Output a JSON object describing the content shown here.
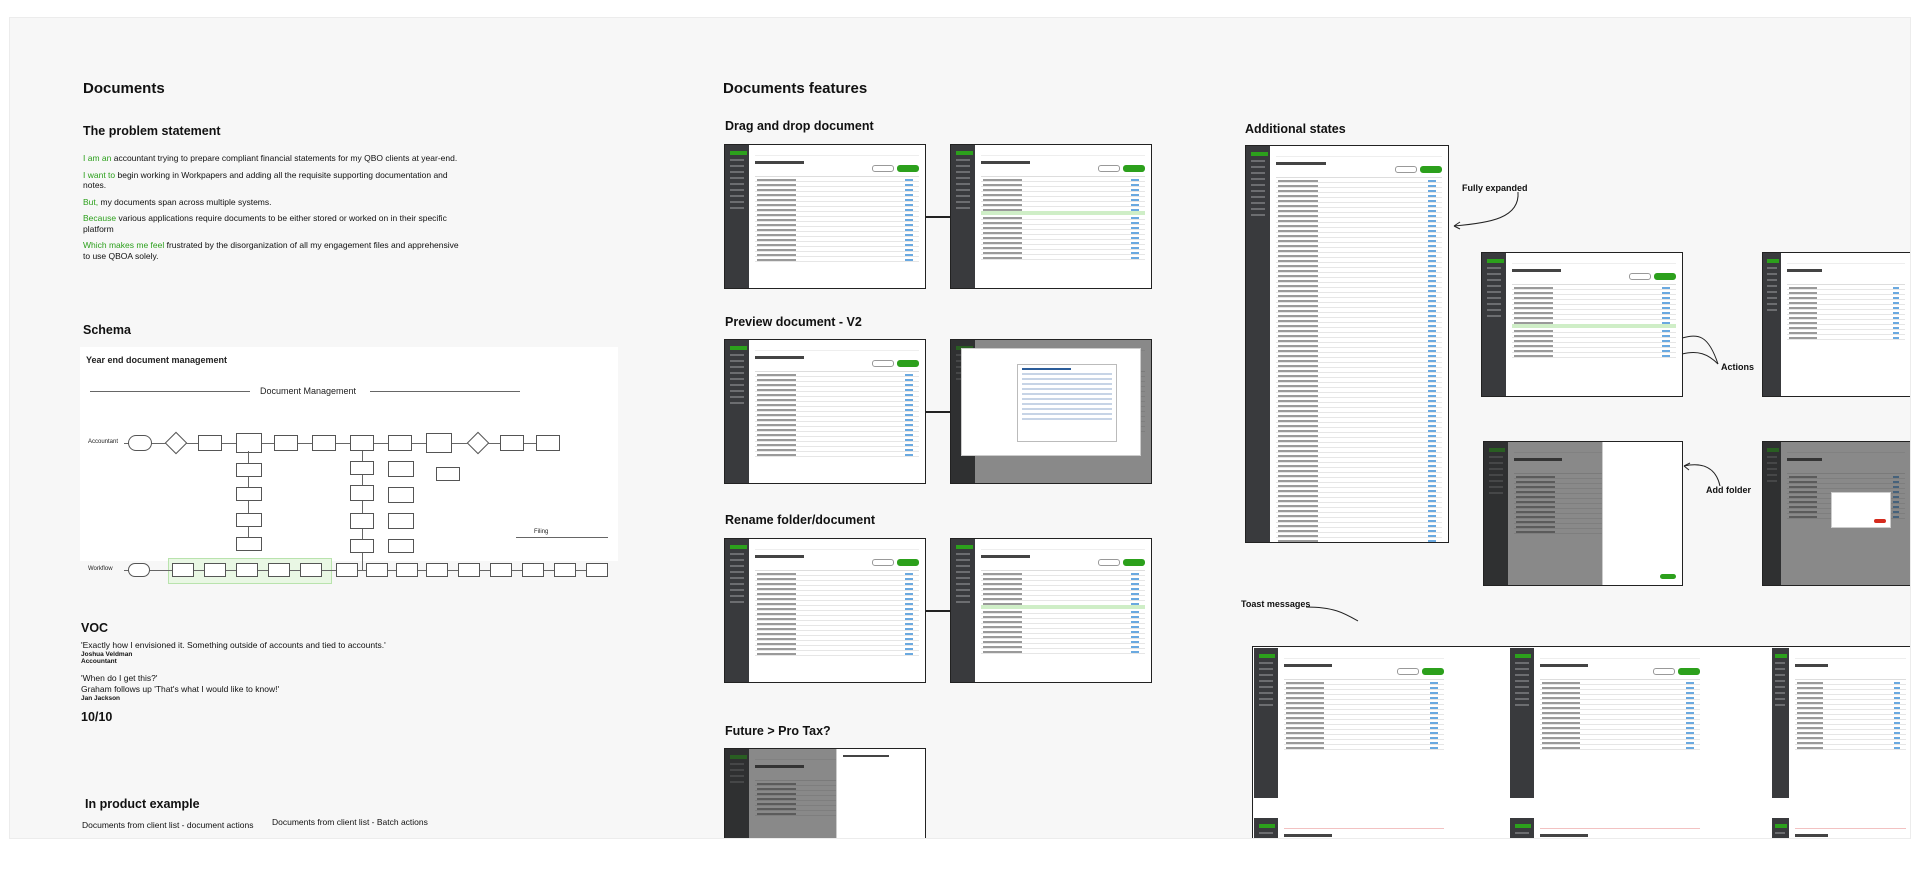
{
  "left": {
    "title": "Documents",
    "problem": {
      "heading": "The problem statement",
      "lines": [
        {
          "lead": "I am an",
          "rest": " accountant trying to prepare compliant financial statements for my QBO clients at year-end."
        },
        {
          "lead": "I want to",
          "rest": " begin working in Workpapers and adding all the requisite supporting documentation and notes."
        },
        {
          "lead": "But,",
          "rest": " my documents span across multiple systems."
        },
        {
          "lead": "Because",
          "rest": " various applications require documents to be either stored or worked on in their specific platform"
        },
        {
          "lead": "Which makes me feel",
          "rest": " frustrated by the disorganization of all my engagement files and apprehensive to use QBOA solely."
        }
      ]
    },
    "schema": {
      "heading": "Schema",
      "title": "Year end document management",
      "band": "Document Management",
      "row1_label": "Accountant",
      "row2_label": "Workflow",
      "filing": "Filing"
    },
    "voc": {
      "heading": "VOC",
      "quote1": "'Exactly how I envisioned it. Something outside of accounts and tied to accounts.'",
      "name1": "Joshua Veldman",
      "role1": "Accountant",
      "quote2a": "'When do I get this?'",
      "quote2b": "Graham follows up 'That's what I would like to know!'",
      "name2": "Jan Jackson",
      "score": "10/10"
    },
    "example": {
      "heading": "In product example",
      "caption1": "Documents from client list - document actions",
      "caption2": "Documents from client list - Batch actions"
    }
  },
  "middle": {
    "title": "Documents features",
    "sections": [
      "Drag and drop document",
      "Preview document - V2",
      "Rename folder/document",
      "Future  > Pro Tax?"
    ]
  },
  "right": {
    "title": "Additional  states",
    "annotations": {
      "fully_expanded": "Fully expanded",
      "actions": "Actions",
      "add_folder": "Add folder",
      "toast": "Toast messages"
    }
  },
  "colors": {
    "accent": "#2ca01c",
    "sidebar": "#393a3d",
    "canvas": "#f7f7f7"
  }
}
